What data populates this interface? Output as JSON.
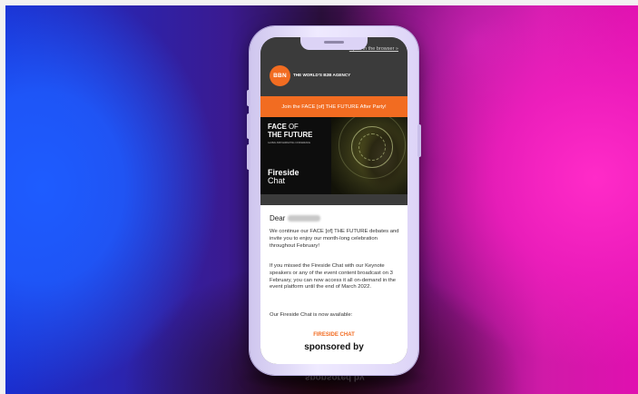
{
  "email": {
    "open_in_browser": "Open in the browser »",
    "logo_text": "BBN",
    "tagline": "THE WORLD'S B2B AGENCY",
    "banner_text": "Join the FACE [of] THE FUTURE After Party!",
    "hero": {
      "event_line1_a": "FACE",
      "event_line1_b": " OF",
      "event_line2": "THE FUTURE",
      "event_sub": "GLOBAL B2B MARKETING CONFERENCE",
      "session_line1": "Fireside",
      "session_line2": "Chat"
    },
    "greeting": "Dear",
    "paragraphs": [
      "We continue our FACE [of] THE FUTURE debates and invite you to enjoy our month-long celebration throughout February!",
      "If you missed the Fireside Chat with our Keynote speakers or any of the event content broadcast on 3 February, you can now access it all on-demand in the event platform until the end of March 2022.",
      "Our Fireside Chat is now available:"
    ],
    "cta_label": "FIRESIDE CHAT",
    "sponsored_by": "sponsored by"
  },
  "colors": {
    "accent": "#f26c21",
    "header_bg": "#3b3b3b",
    "phone_frame": "#e3dcfa"
  }
}
